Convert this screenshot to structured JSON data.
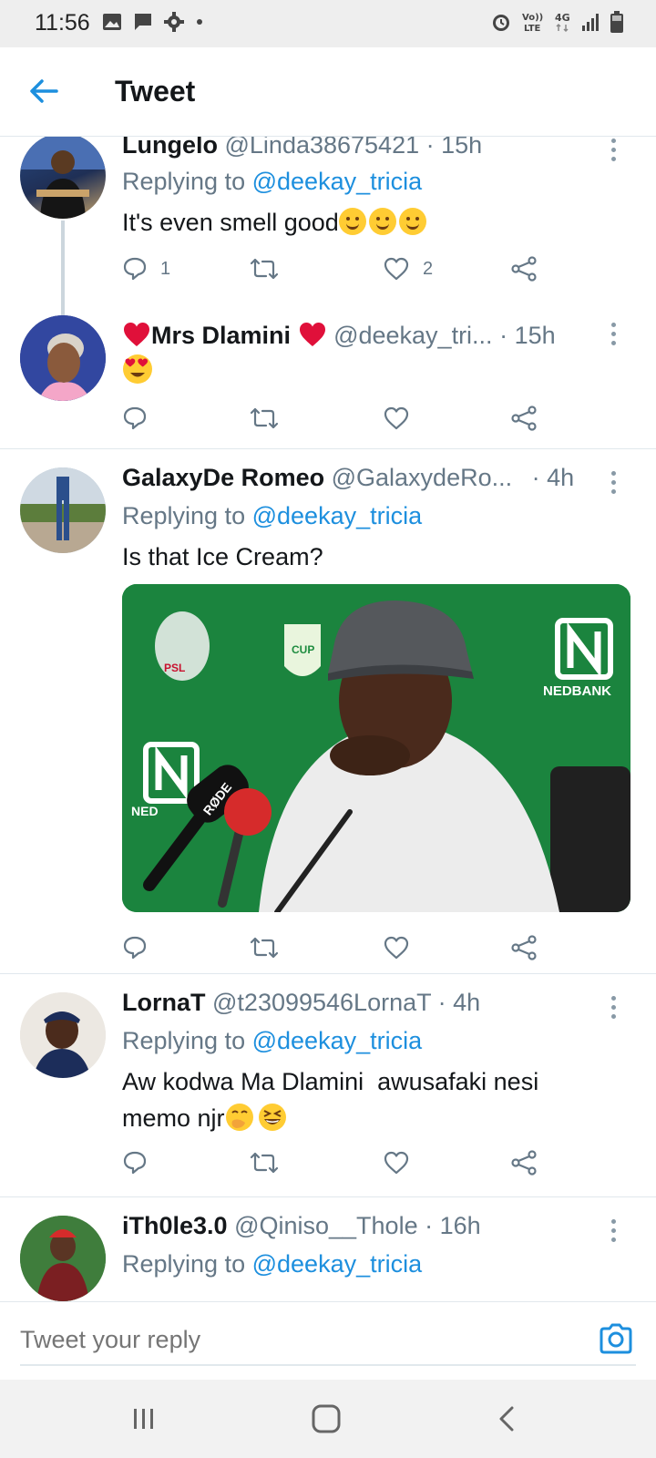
{
  "status_bar": {
    "time": "11:56",
    "network": "4G",
    "volte_line1": "Vo))",
    "volte_line2": "LTE",
    "icons": [
      "image-icon",
      "message-icon",
      "gear-icon",
      "dot-icon",
      "alarm-icon",
      "volte-icon",
      "4g-icon",
      "signal-icon",
      "battery-icon"
    ]
  },
  "header": {
    "title": "Tweet",
    "back_icon": "arrow-left-icon"
  },
  "colors": {
    "accent": "#1d8fde",
    "text": "#14171a",
    "muted": "#657786",
    "divider": "#e1e8ed",
    "heart": "#e0245e"
  },
  "tweets": [
    {
      "name": "Lungelo",
      "handle": "@Linda38675421",
      "time": "· 15h",
      "replying_prefix": "Replying to",
      "replying_to": "@deekay_tricia",
      "text": "It's even smell good",
      "emojis": [
        "yum-face",
        "yum-face",
        "yum-face"
      ],
      "reply_count": "1",
      "retweet_count": "",
      "like_count": "2"
    },
    {
      "name_prefix_emoji": "red-heart",
      "name": "Mrs Dlamini",
      "name_suffix_emoji": "red-heart",
      "handle": "@deekay_tri...",
      "time": "· 15h",
      "text": "",
      "emojis": [
        "heart-eyes-face"
      ],
      "reply_count": "",
      "retweet_count": "",
      "like_count": ""
    },
    {
      "name": "GalaxyDe Romeo",
      "handle": "@GalaxydeRo...",
      "time": "· 4h",
      "replying_prefix": "Replying to",
      "replying_to": "@deekay_tricia",
      "text": "Is that Ice Cream?",
      "media": {
        "alt": "photo",
        "labels": [
          "NEDBANK",
          "RØDE",
          "CUP",
          "PSL",
          "NED"
        ]
      },
      "reply_count": "",
      "retweet_count": "",
      "like_count": ""
    },
    {
      "name": "LornaT",
      "handle": "@t23099546LornaT",
      "time": "· 4h",
      "replying_prefix": "Replying to",
      "replying_to": "@deekay_tricia",
      "text_line1": "Aw kodwa Ma Dlamini  awusafaki nesi",
      "text_line2": "memo njr",
      "emojis": [
        "hand-over-mouth-face",
        "grinning-squint-face"
      ],
      "reply_count": "",
      "retweet_count": "",
      "like_count": ""
    },
    {
      "name": "iTh0le3.0",
      "handle": "@Qiniso__Thole",
      "time": "· 16h",
      "replying_prefix": "Replying to",
      "replying_to": "@deekay_tricia"
    }
  ],
  "composer": {
    "placeholder": "Tweet your reply",
    "camera_icon": "camera-icon"
  },
  "nav_bar": {
    "icons": [
      "recent-apps-icon",
      "home-icon",
      "back-icon"
    ]
  }
}
